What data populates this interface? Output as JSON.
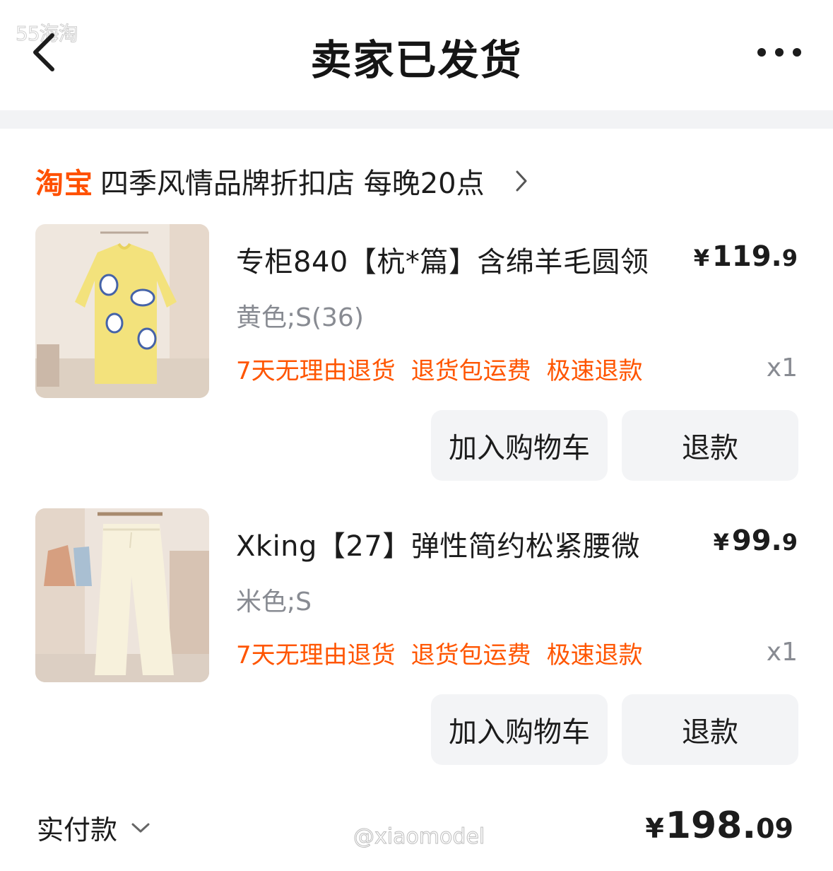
{
  "watermark_top": "55海淘",
  "nav": {
    "title": "卖家已发货"
  },
  "store": {
    "platform": "淘宝",
    "name": "四季风情品牌折扣店 每晚20点"
  },
  "items": [
    {
      "title": "专柜840【杭*篇】含绵羊毛圆领",
      "price_currency": "¥",
      "price_int": "119.",
      "price_dec": "9",
      "sku": "黄色;S(36)",
      "tags": [
        "7天无理由退货",
        "退货包运费",
        "极速退款"
      ],
      "qty": "x1",
      "btn_cart": "加入购物车",
      "btn_refund": "退款",
      "image": "yellow-bunny-sweater"
    },
    {
      "title": "Xking【27】弹性简约松紧腰微",
      "price_currency": "¥",
      "price_int": "99.",
      "price_dec": "9",
      "sku": "米色;S",
      "tags": [
        "7天无理由退货",
        "退货包运费",
        "极速退款"
      ],
      "qty": "x1",
      "btn_cart": "加入购物车",
      "btn_refund": "退款",
      "image": "cream-wide-leg-pants"
    }
  ],
  "summary": {
    "label": "实付款",
    "currency": "¥",
    "total_int": "198.",
    "total_dec": "09"
  },
  "watermark_bottom": "@xiaomodel",
  "colors": {
    "accent": "#ff5000",
    "tag": "#ff5500",
    "muted": "#888b92",
    "button_bg": "#f3f4f6",
    "divider": "#f2f3f5"
  }
}
